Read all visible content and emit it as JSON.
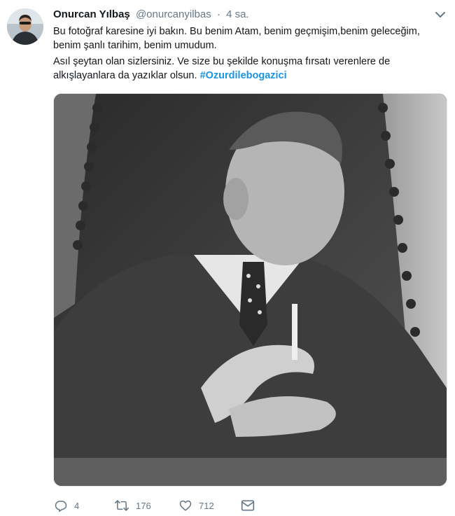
{
  "tweet": {
    "author_name": "Onurcan Yılbaş",
    "author_handle": "@onurcanyilbas",
    "separator": "·",
    "time": "4 sa.",
    "text_line1": "Bu fotoğraf karesine iyi bakın. Bu benim Atam, benim geçmişim,benim geleceğim, benim şanlı tarihim, benim umudum.",
    "text_line2": "Asıl şeytan olan sizlersiniz. Ve size bu şekilde konuşma fırsatı verenlere de alkışlayanlara da yazıklar olsun.",
    "hashtag": "#Ozurdilebogazici"
  },
  "actions": {
    "reply_count": "4",
    "retweet_count": "176",
    "like_count": "712"
  },
  "icons": {
    "reply": "reply-icon",
    "retweet": "retweet-icon",
    "like": "heart-icon",
    "dm": "envelope-icon",
    "menu": "chevron-down-icon"
  },
  "colors": {
    "link": "#1b95e0",
    "muted": "#657786",
    "text": "#14171a"
  }
}
